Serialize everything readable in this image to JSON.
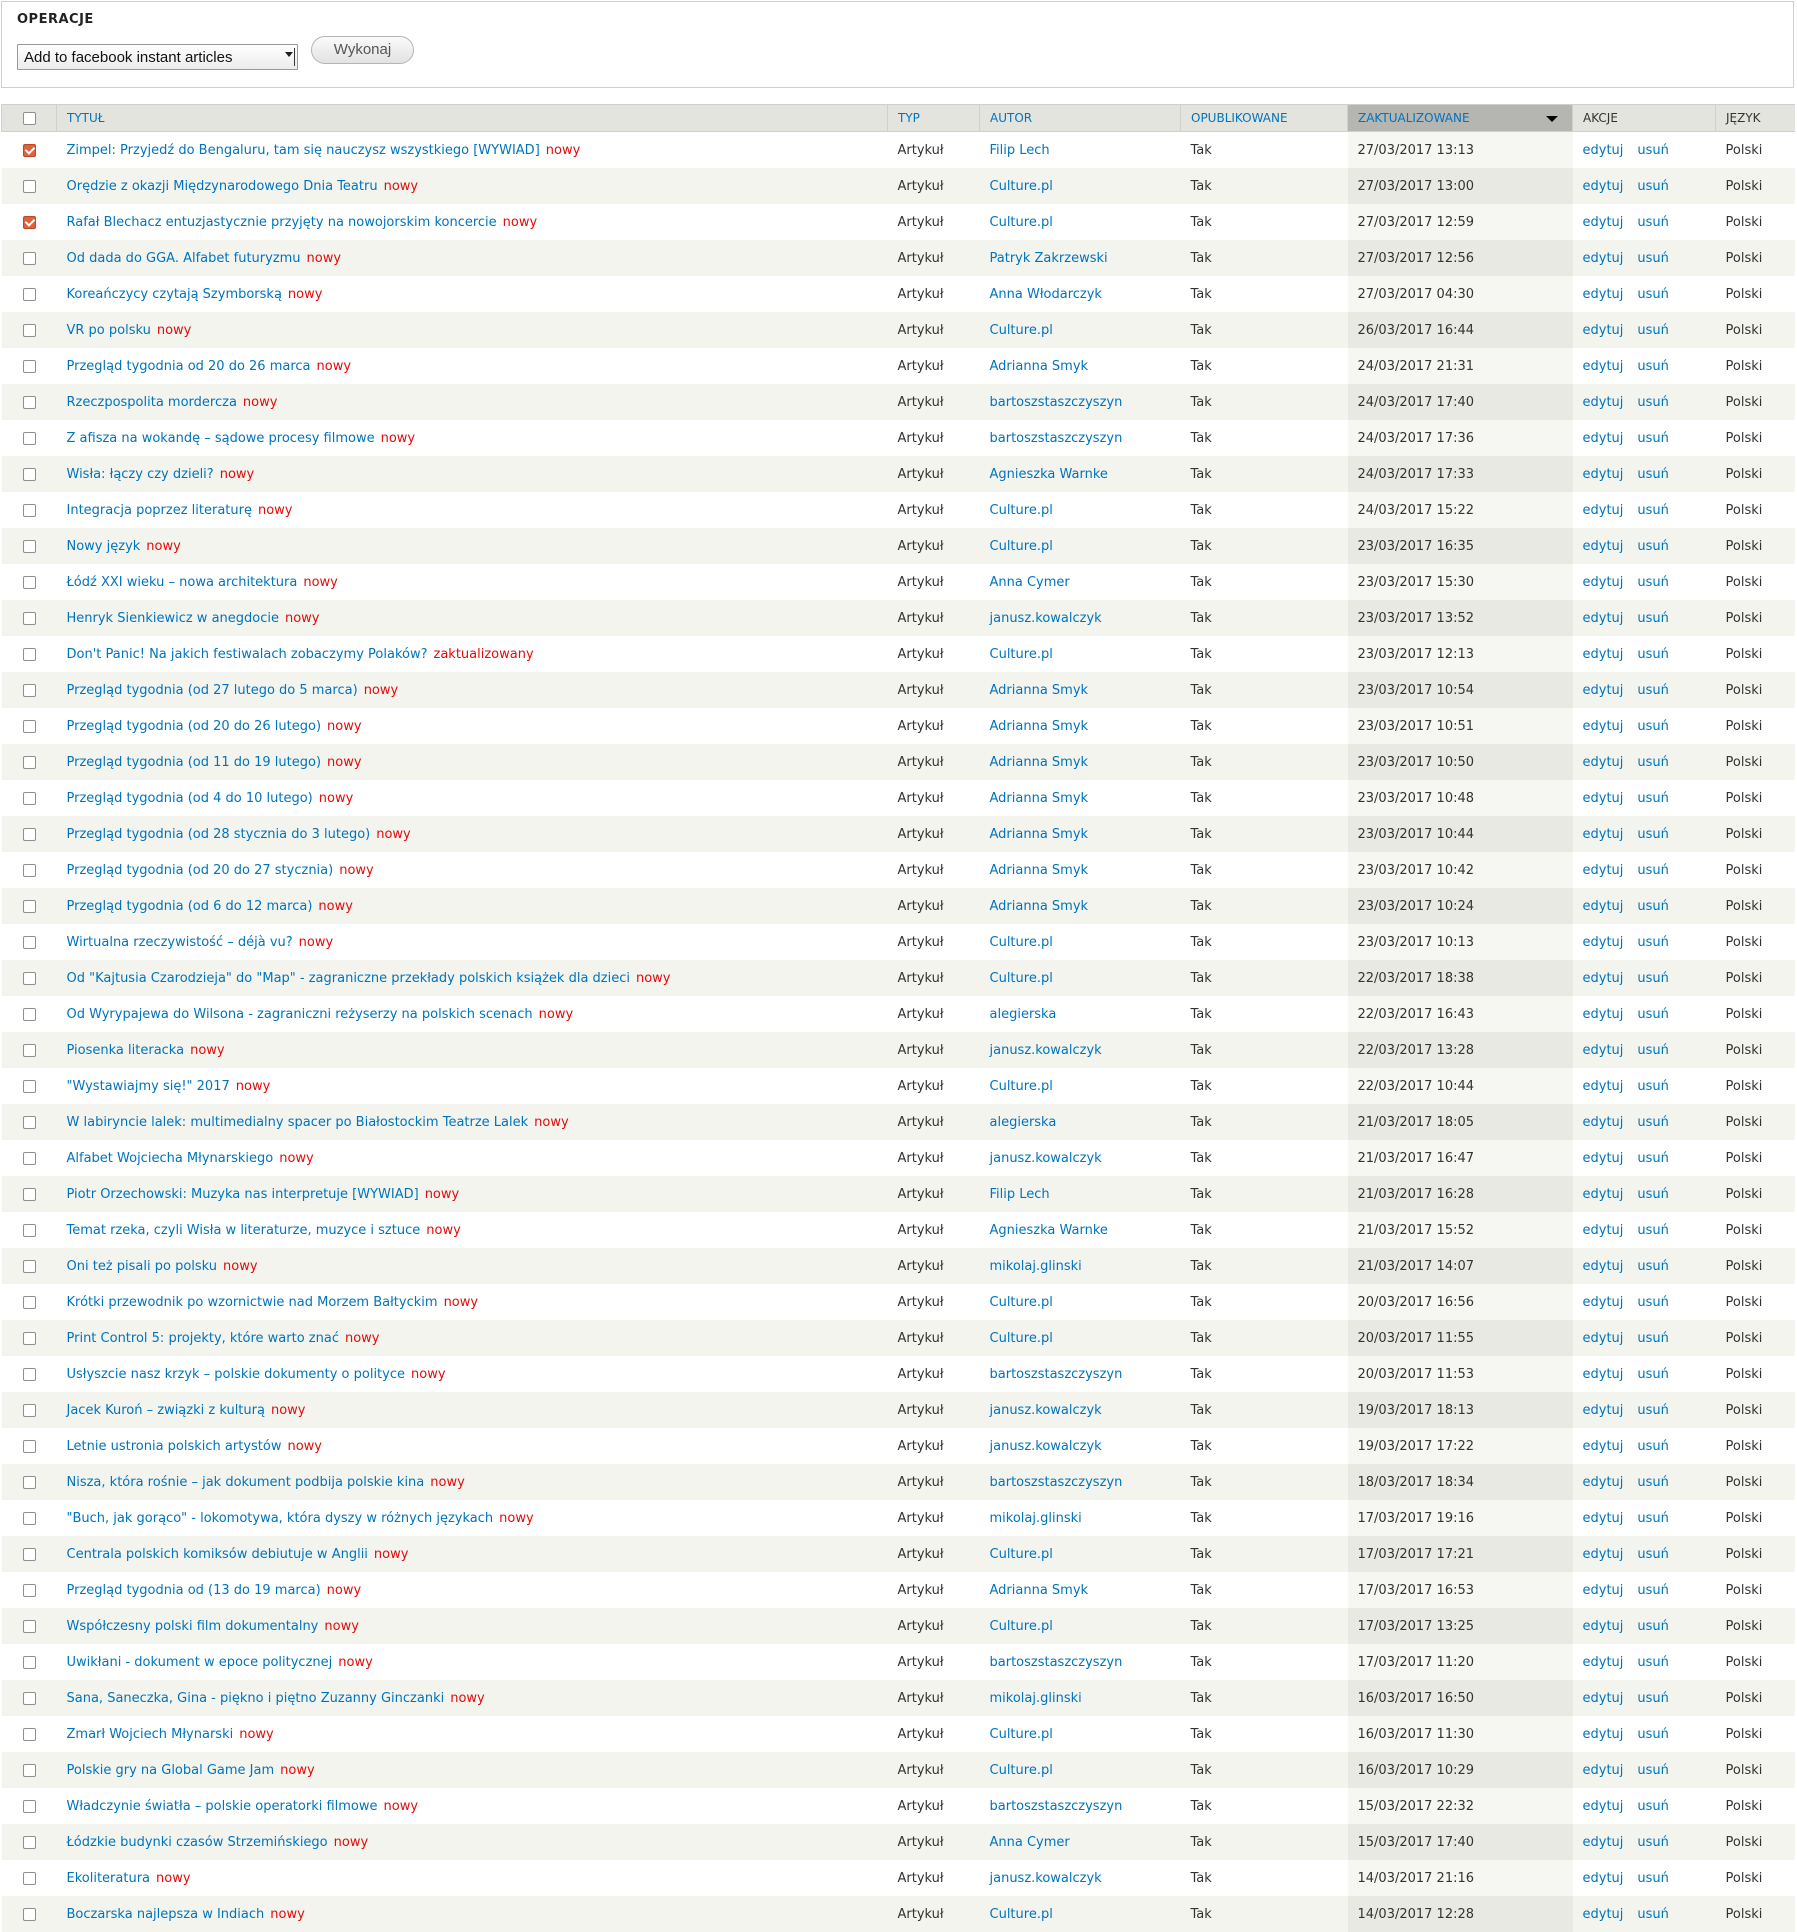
{
  "operations": {
    "title": "OPERACJE",
    "selected_action": "Add to facebook instant articles",
    "execute_label": "Wykonaj"
  },
  "table": {
    "headers": {
      "title": "TYTUŁ",
      "type": "TYP",
      "author": "AUTOR",
      "published": "OPUBLIKOWANE",
      "updated": "ZAKTUALIZOWANE",
      "actions": "AKCJE",
      "language": "JĘZYK"
    },
    "action_labels": {
      "edit": "edytuj",
      "delete": "usuń"
    },
    "rows": [
      {
        "checked": true,
        "title": "Zimpel: Przyjedź do Bengaluru, tam się nauczysz wszystkiego [WYWIAD]",
        "mark": "nowy",
        "type": "Artykuł",
        "author": "Filip Lech",
        "published": "Tak",
        "updated": "27/03/2017 13:13",
        "language": "Polski"
      },
      {
        "checked": false,
        "title": "Orędzie z okazji Międzynarodowego Dnia Teatru",
        "mark": "nowy",
        "type": "Artykuł",
        "author": "Culture.pl",
        "published": "Tak",
        "updated": "27/03/2017 13:00",
        "language": "Polski"
      },
      {
        "checked": true,
        "title": "Rafał Blechacz entuzjastycznie przyjęty na nowojorskim koncercie",
        "mark": "nowy",
        "type": "Artykuł",
        "author": "Culture.pl",
        "published": "Tak",
        "updated": "27/03/2017 12:59",
        "language": "Polski"
      },
      {
        "checked": false,
        "title": "Od dada do GGA. Alfabet futuryzmu",
        "mark": "nowy",
        "type": "Artykuł",
        "author": "Patryk Zakrzewski",
        "published": "Tak",
        "updated": "27/03/2017 12:56",
        "language": "Polski"
      },
      {
        "checked": false,
        "title": "Koreańczycy czytają Szymborską",
        "mark": "nowy",
        "type": "Artykuł",
        "author": "Anna Włodarczyk",
        "published": "Tak",
        "updated": "27/03/2017 04:30",
        "language": "Polski"
      },
      {
        "checked": false,
        "title": "VR po polsku",
        "mark": "nowy",
        "type": "Artykuł",
        "author": "Culture.pl",
        "published": "Tak",
        "updated": "26/03/2017 16:44",
        "language": "Polski"
      },
      {
        "checked": false,
        "title": "Przegląd tygodnia od 20 do 26 marca",
        "mark": "nowy",
        "type": "Artykuł",
        "author": "Adrianna Smyk",
        "published": "Tak",
        "updated": "24/03/2017 21:31",
        "language": "Polski"
      },
      {
        "checked": false,
        "title": "Rzeczpospolita mordercza",
        "mark": "nowy",
        "type": "Artykuł",
        "author": "bartoszstaszczyszyn",
        "published": "Tak",
        "updated": "24/03/2017 17:40",
        "language": "Polski"
      },
      {
        "checked": false,
        "title": "Z afisza na wokandę – sądowe procesy filmowe",
        "mark": "nowy",
        "type": "Artykuł",
        "author": "bartoszstaszczyszyn",
        "published": "Tak",
        "updated": "24/03/2017 17:36",
        "language": "Polski"
      },
      {
        "checked": false,
        "title": "Wisła: łączy czy dzieli?",
        "mark": "nowy",
        "type": "Artykuł",
        "author": "Agnieszka Warnke",
        "published": "Tak",
        "updated": "24/03/2017 17:33",
        "language": "Polski"
      },
      {
        "checked": false,
        "title": "Integracja poprzez literaturę",
        "mark": "nowy",
        "type": "Artykuł",
        "author": "Culture.pl",
        "published": "Tak",
        "updated": "24/03/2017 15:22",
        "language": "Polski"
      },
      {
        "checked": false,
        "title": "Nowy język",
        "mark": "nowy",
        "type": "Artykuł",
        "author": "Culture.pl",
        "published": "Tak",
        "updated": "23/03/2017 16:35",
        "language": "Polski"
      },
      {
        "checked": false,
        "title": "Łódź XXI wieku – nowa architektura",
        "mark": "nowy",
        "type": "Artykuł",
        "author": "Anna Cymer",
        "published": "Tak",
        "updated": "23/03/2017 15:30",
        "language": "Polski"
      },
      {
        "checked": false,
        "title": "Henryk Sienkiewicz w anegdocie",
        "mark": "nowy",
        "type": "Artykuł",
        "author": "janusz.kowalczyk",
        "published": "Tak",
        "updated": "23/03/2017 13:52",
        "language": "Polski"
      },
      {
        "checked": false,
        "title": "Don't Panic! Na jakich festiwalach zobaczymy Polaków?",
        "mark": "zaktualizowany",
        "type": "Artykuł",
        "author": "Culture.pl",
        "published": "Tak",
        "updated": "23/03/2017 12:13",
        "language": "Polski"
      },
      {
        "checked": false,
        "title": "Przegląd tygodnia (od 27 lutego do 5 marca)",
        "mark": "nowy",
        "type": "Artykuł",
        "author": "Adrianna Smyk",
        "published": "Tak",
        "updated": "23/03/2017 10:54",
        "language": "Polski"
      },
      {
        "checked": false,
        "title": "Przegląd tygodnia (od 20 do 26 lutego)",
        "mark": "nowy",
        "type": "Artykuł",
        "author": "Adrianna Smyk",
        "published": "Tak",
        "updated": "23/03/2017 10:51",
        "language": "Polski"
      },
      {
        "checked": false,
        "title": "Przegląd tygodnia (od 11 do 19 lutego)",
        "mark": "nowy",
        "type": "Artykuł",
        "author": "Adrianna Smyk",
        "published": "Tak",
        "updated": "23/03/2017 10:50",
        "language": "Polski"
      },
      {
        "checked": false,
        "title": "Przegląd tygodnia (od 4 do 10 lutego)",
        "mark": "nowy",
        "type": "Artykuł",
        "author": "Adrianna Smyk",
        "published": "Tak",
        "updated": "23/03/2017 10:48",
        "language": "Polski"
      },
      {
        "checked": false,
        "title": "Przegląd tygodnia (od 28 stycznia do 3 lutego)",
        "mark": "nowy",
        "type": "Artykuł",
        "author": "Adrianna Smyk",
        "published": "Tak",
        "updated": "23/03/2017 10:44",
        "language": "Polski"
      },
      {
        "checked": false,
        "title": "Przegląd tygodnia (od 20 do 27 stycznia)",
        "mark": "nowy",
        "type": "Artykuł",
        "author": "Adrianna Smyk",
        "published": "Tak",
        "updated": "23/03/2017 10:42",
        "language": "Polski"
      },
      {
        "checked": false,
        "title": "Przegląd tygodnia (od 6 do 12 marca)",
        "mark": "nowy",
        "type": "Artykuł",
        "author": "Adrianna Smyk",
        "published": "Tak",
        "updated": "23/03/2017 10:24",
        "language": "Polski"
      },
      {
        "checked": false,
        "title": "Wirtualna rzeczywistość – déjà vu?",
        "mark": "nowy",
        "type": "Artykuł",
        "author": "Culture.pl",
        "published": "Tak",
        "updated": "23/03/2017 10:13",
        "language": "Polski"
      },
      {
        "checked": false,
        "title": "Od \"Kajtusia Czarodzieja\" do \"Map\" - zagraniczne przekłady polskich książek dla dzieci",
        "mark": "nowy",
        "type": "Artykuł",
        "author": "Culture.pl",
        "published": "Tak",
        "updated": "22/03/2017 18:38",
        "language": "Polski"
      },
      {
        "checked": false,
        "title": "Od Wyrypajewa do Wilsona - zagraniczni reżyserzy na polskich scenach",
        "mark": "nowy",
        "type": "Artykuł",
        "author": "alegierska",
        "published": "Tak",
        "updated": "22/03/2017 16:43",
        "language": "Polski"
      },
      {
        "checked": false,
        "title": "Piosenka literacka",
        "mark": "nowy",
        "type": "Artykuł",
        "author": "janusz.kowalczyk",
        "published": "Tak",
        "updated": "22/03/2017 13:28",
        "language": "Polski"
      },
      {
        "checked": false,
        "title": "\"Wystawiajmy się!\" 2017",
        "mark": "nowy",
        "type": "Artykuł",
        "author": "Culture.pl",
        "published": "Tak",
        "updated": "22/03/2017 10:44",
        "language": "Polski"
      },
      {
        "checked": false,
        "title": "W labiryncie lalek: multimedialny spacer po Białostockim Teatrze Lalek",
        "mark": "nowy",
        "type": "Artykuł",
        "author": "alegierska",
        "published": "Tak",
        "updated": "21/03/2017 18:05",
        "language": "Polski"
      },
      {
        "checked": false,
        "title": "Alfabet Wojciecha Młynarskiego",
        "mark": "nowy",
        "type": "Artykuł",
        "author": "janusz.kowalczyk",
        "published": "Tak",
        "updated": "21/03/2017 16:47",
        "language": "Polski"
      },
      {
        "checked": false,
        "title": "Piotr Orzechowski: Muzyka nas interpretuje [WYWIAD]",
        "mark": "nowy",
        "type": "Artykuł",
        "author": "Filip Lech",
        "published": "Tak",
        "updated": "21/03/2017 16:28",
        "language": "Polski"
      },
      {
        "checked": false,
        "title": "Temat rzeka, czyli Wisła w literaturze, muzyce i sztuce",
        "mark": "nowy",
        "type": "Artykuł",
        "author": "Agnieszka Warnke",
        "published": "Tak",
        "updated": "21/03/2017 15:52",
        "language": "Polski"
      },
      {
        "checked": false,
        "title": "Oni też pisali po polsku",
        "mark": "nowy",
        "type": "Artykuł",
        "author": "mikolaj.glinski",
        "published": "Tak",
        "updated": "21/03/2017 14:07",
        "language": "Polski"
      },
      {
        "checked": false,
        "title": "Krótki przewodnik po wzornictwie nad Morzem Bałtyckim",
        "mark": "nowy",
        "type": "Artykuł",
        "author": "Culture.pl",
        "published": "Tak",
        "updated": "20/03/2017 16:56",
        "language": "Polski"
      },
      {
        "checked": false,
        "title": "Print Control 5: projekty, które warto znać",
        "mark": "nowy",
        "type": "Artykuł",
        "author": "Culture.pl",
        "published": "Tak",
        "updated": "20/03/2017 11:55",
        "language": "Polski"
      },
      {
        "checked": false,
        "title": "Usłyszcie nasz krzyk – polskie dokumenty o polityce",
        "mark": "nowy",
        "type": "Artykuł",
        "author": "bartoszstaszczyszyn",
        "published": "Tak",
        "updated": "20/03/2017 11:53",
        "language": "Polski"
      },
      {
        "checked": false,
        "title": "Jacek Kuroń – związki z kulturą",
        "mark": "nowy",
        "type": "Artykuł",
        "author": "janusz.kowalczyk",
        "published": "Tak",
        "updated": "19/03/2017 18:13",
        "language": "Polski"
      },
      {
        "checked": false,
        "title": "Letnie ustronia polskich artystów",
        "mark": "nowy",
        "type": "Artykuł",
        "author": "janusz.kowalczyk",
        "published": "Tak",
        "updated": "19/03/2017 17:22",
        "language": "Polski"
      },
      {
        "checked": false,
        "title": "Nisza, która rośnie – jak dokument podbija polskie kina",
        "mark": "nowy",
        "type": "Artykuł",
        "author": "bartoszstaszczyszyn",
        "published": "Tak",
        "updated": "18/03/2017 18:34",
        "language": "Polski"
      },
      {
        "checked": false,
        "title": "\"Buch, jak gorąco\" - lokomotywa, która dyszy w różnych językach",
        "mark": "nowy",
        "type": "Artykuł",
        "author": "mikolaj.glinski",
        "published": "Tak",
        "updated": "17/03/2017 19:16",
        "language": "Polski"
      },
      {
        "checked": false,
        "title": "Centrala polskich komiksów debiutuje w Anglii",
        "mark": "nowy",
        "type": "Artykuł",
        "author": "Culture.pl",
        "published": "Tak",
        "updated": "17/03/2017 17:21",
        "language": "Polski"
      },
      {
        "checked": false,
        "title": "Przegląd tygodnia od (13 do 19 marca)",
        "mark": "nowy",
        "type": "Artykuł",
        "author": "Adrianna Smyk",
        "published": "Tak",
        "updated": "17/03/2017 16:53",
        "language": "Polski"
      },
      {
        "checked": false,
        "title": "Współczesny polski film dokumentalny",
        "mark": "nowy",
        "type": "Artykuł",
        "author": "Culture.pl",
        "published": "Tak",
        "updated": "17/03/2017 13:25",
        "language": "Polski"
      },
      {
        "checked": false,
        "title": "Uwikłani - dokument w epoce politycznej",
        "mark": "nowy",
        "type": "Artykuł",
        "author": "bartoszstaszczyszyn",
        "published": "Tak",
        "updated": "17/03/2017 11:20",
        "language": "Polski"
      },
      {
        "checked": false,
        "title": "Sana, Saneczka, Gina - piękno i piętno Zuzanny Ginczanki",
        "mark": "nowy",
        "type": "Artykuł",
        "author": "mikolaj.glinski",
        "published": "Tak",
        "updated": "16/03/2017 16:50",
        "language": "Polski"
      },
      {
        "checked": false,
        "title": "Zmarł Wojciech Młynarski",
        "mark": "nowy",
        "type": "Artykuł",
        "author": "Culture.pl",
        "published": "Tak",
        "updated": "16/03/2017 11:30",
        "language": "Polski"
      },
      {
        "checked": false,
        "title": "Polskie gry na Global Game Jam",
        "mark": "nowy",
        "type": "Artykuł",
        "author": "Culture.pl",
        "published": "Tak",
        "updated": "16/03/2017 10:29",
        "language": "Polski"
      },
      {
        "checked": false,
        "title": "Władczynie światła – polskie operatorki filmowe",
        "mark": "nowy",
        "type": "Artykuł",
        "author": "bartoszstaszczyszyn",
        "published": "Tak",
        "updated": "15/03/2017 22:32",
        "language": "Polski"
      },
      {
        "checked": false,
        "title": "Łódzkie budynki czasów Strzemińskiego",
        "mark": "nowy",
        "type": "Artykuł",
        "author": "Anna Cymer",
        "published": "Tak",
        "updated": "15/03/2017 17:40",
        "language": "Polski"
      },
      {
        "checked": false,
        "title": "Ekoliteratura",
        "mark": "nowy",
        "type": "Artykuł",
        "author": "janusz.kowalczyk",
        "published": "Tak",
        "updated": "14/03/2017 21:16",
        "language": "Polski"
      },
      {
        "checked": false,
        "title": "Boczarska najlepsza w Indiach",
        "mark": "nowy",
        "type": "Artykuł",
        "author": "Culture.pl",
        "published": "Tak",
        "updated": "14/03/2017 12:28",
        "language": "Polski"
      }
    ]
  },
  "colors": {
    "link": "#0074bd",
    "status_mark": "#e30b0b",
    "checkbox_checked": "#e0623c",
    "header_bg": "#e4e4de",
    "sorted_header_bg": "#b5b5b2",
    "row_alt_bg": "#f3f4ee"
  },
  "icons": {
    "sort": "sort-desc-icon",
    "select": "chevron-down-icon"
  }
}
